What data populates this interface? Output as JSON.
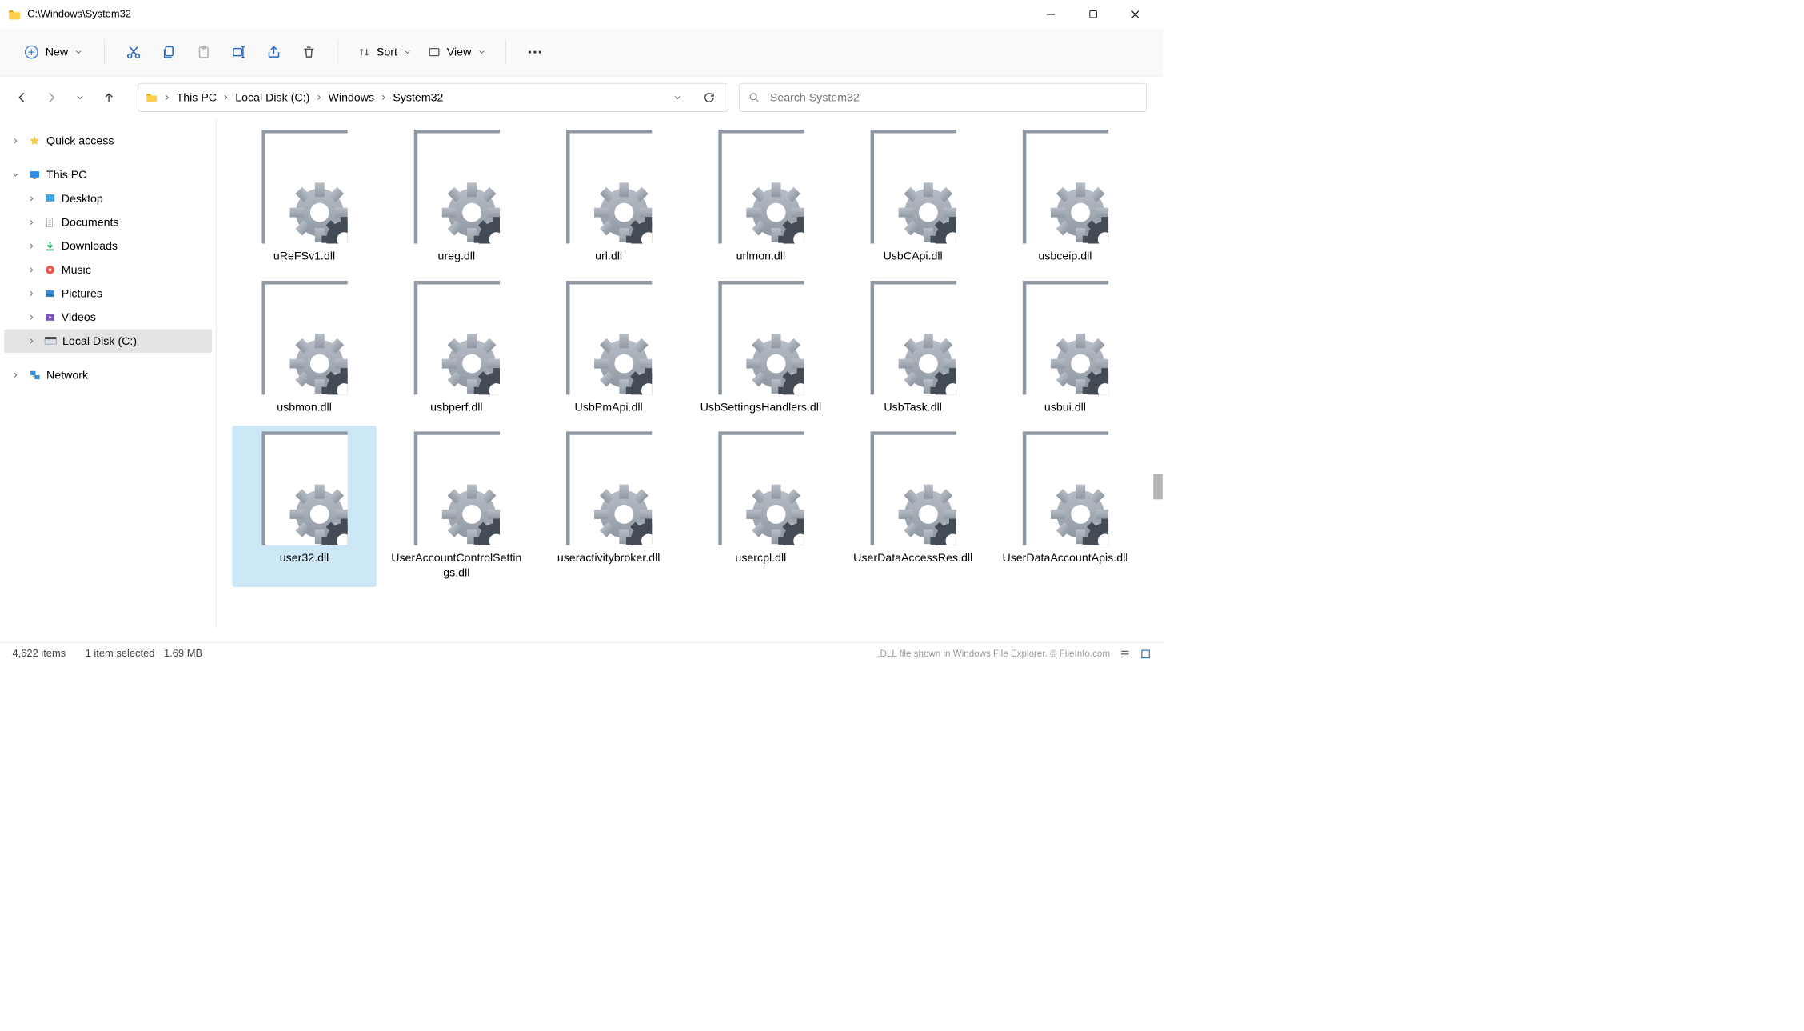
{
  "window": {
    "title": "C:\\Windows\\System32"
  },
  "toolbar": {
    "new_label": "New",
    "sort_label": "Sort",
    "view_label": "View"
  },
  "breadcrumbs": [
    "This PC",
    "Local Disk (C:)",
    "Windows",
    "System32"
  ],
  "search": {
    "placeholder": "Search System32"
  },
  "sidebar": {
    "quick_access": "Quick access",
    "this_pc": "This PC",
    "desktop": "Desktop",
    "documents": "Documents",
    "downloads": "Downloads",
    "music": "Music",
    "pictures": "Pictures",
    "videos": "Videos",
    "local_disk": "Local Disk (C:)",
    "network": "Network"
  },
  "files": [
    "uReFSv1.dll",
    "ureg.dll",
    "url.dll",
    "urlmon.dll",
    "UsbCApi.dll",
    "usbceip.dll",
    "usbmon.dll",
    "usbperf.dll",
    "UsbPmApi.dll",
    "UsbSettingsHandlers.dll",
    "UsbTask.dll",
    "usbui.dll",
    "user32.dll",
    "UserAccountControlSettings.dll",
    "useractivitybroker.dll",
    "usercpl.dll",
    "UserDataAccessRes.dll",
    "UserDataAccountApis.dll"
  ],
  "selected_index": 12,
  "status": {
    "count": "4,622 items",
    "selected": "1 item selected",
    "size": "1.69 MB",
    "caption": ".DLL file shown in Windows File Explorer. © FileInfo.com"
  }
}
